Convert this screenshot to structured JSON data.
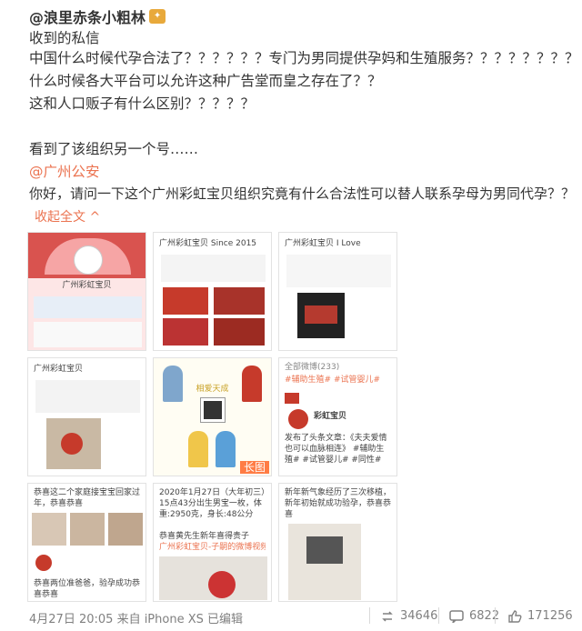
{
  "post": {
    "author": "@浪里赤条小粗林",
    "lines": [
      "收到的私信",
      "中国什么时候代孕合法了？？？？？？专门为男同提供孕妈和生殖服务？？？？？？？？",
      "什么时候各大平台可以允许这种广告堂而皇之存在了？？",
      "这和人口贩子有什么区别？？？？？",
      "看到了该组织另一个号……",
      "@广州公安",
      "你好，请问一下这个广州彩虹宝贝组织究竟有什么合法性可以替人联系孕母为男同代孕？？"
    ],
    "collapse": "收起全文 ^"
  },
  "images": {
    "t1_title": "广州彩虹宝贝",
    "t2_text": "广州彩虹宝贝 Since 2015",
    "t3_text": "广州彩虹宝贝 I Love",
    "t4_text": "广州彩虹宝贝",
    "t5_title": "相爱天成",
    "t5_tag": "长图",
    "t6_head": "全部微博(233)",
    "t6_tags": "#辅助生殖#    #试管婴儿#",
    "t6_name": "彩虹宝贝",
    "t6_body": "发布了头条文章：《夫夫爱情也可以血脉相连》 #辅助生殖# #试管婴儿# #同性#",
    "t7_text": "恭喜这二个家庭接宝宝回家过年，恭喜恭喜",
    "t7_foot": "恭喜两位准爸爸，验孕成功恭喜恭喜",
    "t8_text": "2020年1月27日（大年初三）15点43分出生男宝一枚，体重:2950克，身长:48公分",
    "t8_foot": "恭喜黄先生新年喜得贵子",
    "t8_link": "广州彩虹宝贝-子嗣的微博视频",
    "t9_text": "新年新气象经历了三次移植，新年初始就成功验孕，恭喜恭喜"
  },
  "footer": {
    "timestamp": "4月27日 20:05",
    "source": "来自 iPhone XS",
    "edited": "已编辑",
    "reposts": "34646",
    "comments": "6822",
    "likes": "171256"
  }
}
